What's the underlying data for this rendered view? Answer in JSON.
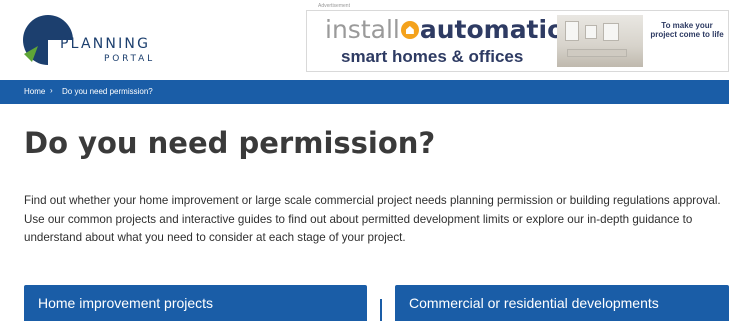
{
  "header": {
    "logo": {
      "line1": "PLANNING",
      "line2": "PORTAL"
    },
    "ad": {
      "label": "Advertisement",
      "brand_prefix": "install",
      "brand_suffix": "automation",
      "line2": "smart homes & offices",
      "tagline": "To make your project come to life"
    }
  },
  "breadcrumb": {
    "home": "Home",
    "separator": "›",
    "current": "Do you need permission?"
  },
  "main": {
    "title": "Do you need permission?",
    "intro": "Find out whether your home improvement or large scale commercial project needs planning permission or building regulations approval. Use our common projects and interactive guides to find out about permitted development limits or explore our in-depth guidance to understand about what you need to consider at each stage of your project.",
    "cards": [
      {
        "label": "Home improvement projects"
      },
      {
        "label": "Commercial or residential developments"
      }
    ]
  },
  "colors": {
    "brand_blue": "#1a5da7",
    "navy": "#1c3f6e",
    "green": "#5fa537",
    "ad_orange": "#f4a21c"
  }
}
